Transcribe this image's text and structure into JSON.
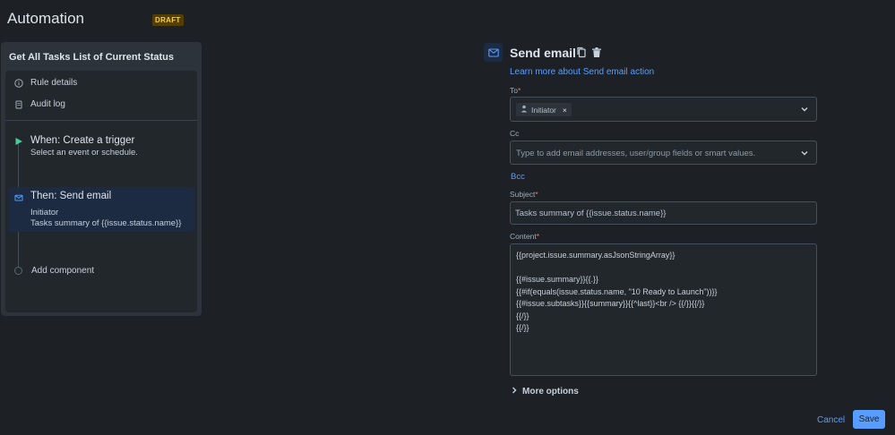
{
  "header": {
    "title": "Automation",
    "badge": "DRAFT"
  },
  "rule": {
    "title": "Get All Tasks List of Current Status",
    "nav": [
      {
        "label": "Rule details",
        "icon": "info-icon"
      },
      {
        "label": "Audit log",
        "icon": "document-icon"
      }
    ],
    "steps": {
      "when": {
        "title": "When: Create a trigger",
        "subtitle": "Select an event or schedule."
      },
      "then": {
        "title": "Then: Send email",
        "line1": "Initiator",
        "line2": "Tasks summary of {{issue.status.name}}"
      },
      "add": {
        "label": "Add component"
      }
    }
  },
  "form": {
    "title": "Send email",
    "learn_more": "Learn more about Send email action",
    "to": {
      "label": "To",
      "required_mark": "*",
      "chip": "Initiator",
      "chip_remove": "×"
    },
    "cc": {
      "label": "Cc",
      "placeholder": "Type to add email addresses, user/group fields or smart values."
    },
    "bcc": "Bcc",
    "subject": {
      "label": "Subject",
      "required_mark": "*",
      "value": "Tasks summary of {{issue.status.name}}"
    },
    "content": {
      "label": "Content",
      "required_mark": "*",
      "value": "{{project.issue.summary.asJsonStringArray}}\n\n{{#issue.summary}}{{.}}\n{{#if(equals(issue.status.name, \"10 Ready to Launch\"))}}\n{{#issue.subtasks}}{{summary}}{{^last}}<br /> {{/}}{{/}}\n{{/}}\n{{/}}"
    },
    "more_options": "More options",
    "cancel": "Cancel",
    "save": "Save"
  },
  "colors": {
    "accent": "#579dff",
    "badge_bg": "#533f04",
    "badge_text": "#f5cd47",
    "trigger_green": "#4bce97",
    "required": "#f87168"
  }
}
